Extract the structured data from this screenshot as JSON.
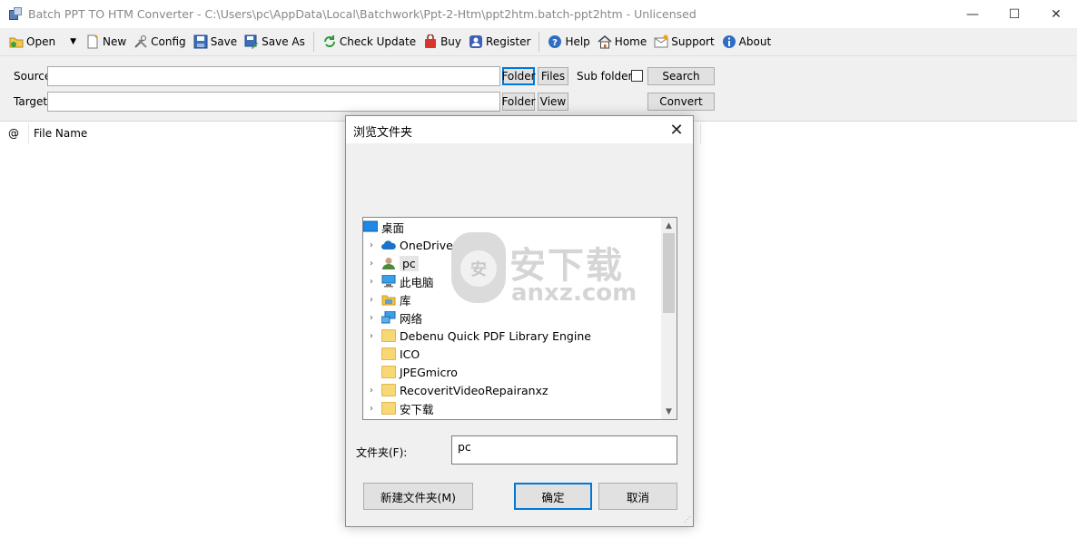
{
  "window": {
    "title": "Batch PPT TO HTM Converter - C:\\Users\\pc\\AppData\\Local\\Batchwork\\Ppt-2-Htm\\ppt2htm.batch-ppt2htm - Unlicensed",
    "minimize": "—",
    "maximize": "☐",
    "close": "✕"
  },
  "toolbar": {
    "open": "Open",
    "new": "New",
    "config": "Config",
    "save": "Save",
    "save_as": "Save As",
    "check_update": "Check Update",
    "buy": "Buy",
    "register": "Register",
    "help": "Help",
    "home": "Home",
    "support": "Support",
    "about": "About"
  },
  "form": {
    "source_label": "Source",
    "target_label": "Target",
    "source_value": "",
    "target_value": "",
    "folder_btn": "Folder",
    "files_btn": "Files",
    "view_btn": "View",
    "subfolders_label": "Sub folders",
    "search_btn": "Search",
    "convert_btn": "Convert"
  },
  "list": {
    "col_at": "@",
    "col_filename": "File Name"
  },
  "dialog": {
    "title": "浏览文件夹",
    "close": "✕",
    "tree": [
      {
        "label": "桌面",
        "icon": "desktop-icon",
        "expander": "",
        "indent": 0
      },
      {
        "label": "OneDrive",
        "icon": "cloud-icon",
        "expander": "›",
        "indent": 1
      },
      {
        "label": "pc",
        "icon": "user-icon",
        "expander": "›",
        "indent": 1,
        "selected": true
      },
      {
        "label": "此电脑",
        "icon": "computer-icon",
        "expander": "›",
        "indent": 1
      },
      {
        "label": "库",
        "icon": "library-icon",
        "expander": "›",
        "indent": 1
      },
      {
        "label": "网络",
        "icon": "network-icon",
        "expander": "›",
        "indent": 1
      },
      {
        "label": "Debenu Quick PDF Library Engine",
        "icon": "folder-icon",
        "expander": "›",
        "indent": 1
      },
      {
        "label": "ICO",
        "icon": "folder-icon",
        "expander": "",
        "indent": 1
      },
      {
        "label": "JPEGmicro",
        "icon": "folder-icon",
        "expander": "",
        "indent": 1
      },
      {
        "label": "RecoveritVideoRepairanxz",
        "icon": "folder-icon",
        "expander": "›",
        "indent": 1
      },
      {
        "label": "安下载",
        "icon": "folder-icon",
        "expander": "›",
        "indent": 1
      }
    ],
    "folder_label": "文件夹(F):",
    "folder_value": "pc",
    "new_folder_btn": "新建文件夹(M)",
    "ok_btn": "确定",
    "cancel_btn": "取消"
  },
  "watermark": {
    "cn": "安下载",
    "en": "anxz.com",
    "glyph": "安"
  },
  "colors": {
    "accent": "#0078d7",
    "toolbar_bg": "#f0f0f0",
    "folder": "#f8d775"
  }
}
